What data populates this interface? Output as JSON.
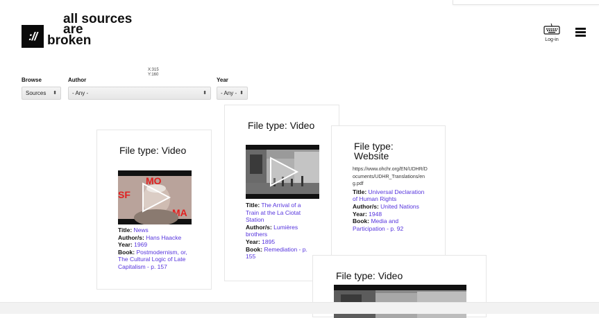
{
  "logo": {
    "mark": "://",
    "line1": "all sources",
    "line2": "are",
    "line3": "broken"
  },
  "header": {
    "login_label": "Log-in",
    "login_icon": "keyboard-icon",
    "menu_icon": "hamburger-menu-icon"
  },
  "coords": {
    "x": "X:315",
    "y": "Y:160"
  },
  "filters": {
    "browse": {
      "label": "Browse",
      "value": "Sources"
    },
    "author": {
      "label": "Author",
      "value": "- Any -"
    },
    "year": {
      "label": "Year",
      "value": "- Any -"
    }
  },
  "cards": [
    {
      "file_type": "File type: Video",
      "title_label": "Title:",
      "title": "News",
      "author_label": "Author/s:",
      "author": "Hans Haacke",
      "year_label": "Year:",
      "year": "1969",
      "book_label": "Book:",
      "book": "Postmodernism, or, The Cultural Logic of Late Capitalism - p. 157"
    },
    {
      "file_type": "File type: Video",
      "title_label": "Title:",
      "title": "The Arrival of a Train at the La Ciotat Station",
      "author_label": "Author/s:",
      "author": "Lumières brothers",
      "year_label": "Year:",
      "year": "1895",
      "book_label": "Book:",
      "book": "Remediation - p. 155"
    },
    {
      "file_type": "File type: Website",
      "url": "https://www.ohchr.org/EN/UDHR/Documents/UDHR_Translations/eng.pdf",
      "title_label": "Title:",
      "title": "Universal Declaration of Human Rights",
      "author_label": "Author/s:",
      "author": "United Nations",
      "year_label": "Year:",
      "year": "1948",
      "book_label": "Book:",
      "book": "Media and Participation - p. 92"
    },
    {
      "file_type": "File type: Video"
    }
  ],
  "colors": {
    "link": "#5533dd",
    "logo_box": "#0a0a0a"
  }
}
